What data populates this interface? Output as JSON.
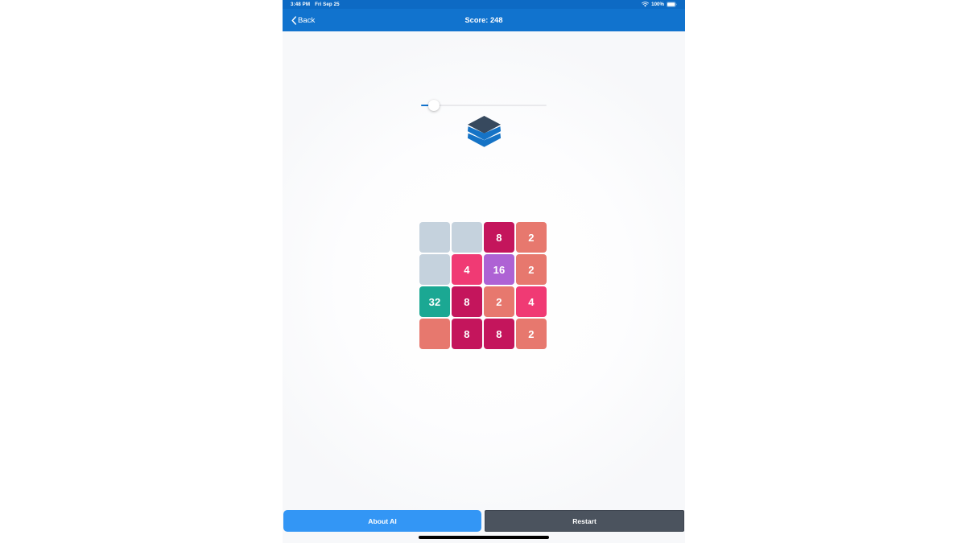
{
  "status_bar": {
    "time": "3:48 PM",
    "date": "Fri Sep 25",
    "wifi_icon": "wifi-icon",
    "battery_percent": "100%",
    "battery_icon": "battery-full-icon",
    "background_color": "#0d6ac4"
  },
  "nav_bar": {
    "back_label": "Back",
    "back_icon": "chevron-left-icon",
    "title": "Score: 248",
    "score_value": 248,
    "background_color": "#1173ce"
  },
  "slider": {
    "name": "speed-slider",
    "value_fraction": 0.077,
    "fill_color": "#1173ce",
    "track_color": "#e9e9ec",
    "thumb_color": "#ffffff"
  },
  "logo": {
    "icon": "layers-stack-icon",
    "top_layer_color": "#37495e",
    "mid_layer_color": "#1573c6",
    "bottom_layer_color": "#1573c6"
  },
  "board": {
    "name": "2048-game-board",
    "rows": 4,
    "columns": 4,
    "empty_color": "#c5d2dd",
    "tiles": [
      [
        {
          "value": "",
          "color": "#c5d2dd",
          "empty": true
        },
        {
          "value": "",
          "color": "#c5d2dd",
          "empty": true
        },
        {
          "value": "8",
          "color": "#c4155c",
          "empty": false
        },
        {
          "value": "2",
          "color": "#e7786e",
          "empty": false
        }
      ],
      [
        {
          "value": "",
          "color": "#c5d2dd",
          "empty": true
        },
        {
          "value": "4",
          "color": "#f03a74",
          "empty": false
        },
        {
          "value": "16",
          "color": "#ae62d4",
          "empty": false
        },
        {
          "value": "2",
          "color": "#e7786e",
          "empty": false
        }
      ],
      [
        {
          "value": "32",
          "color": "#1ba893",
          "empty": false
        },
        {
          "value": "8",
          "color": "#c4155c",
          "empty": false
        },
        {
          "value": "2",
          "color": "#e7786e",
          "empty": false
        },
        {
          "value": "4",
          "color": "#f03a74",
          "empty": false
        }
      ],
      [
        {
          "value": "",
          "color": "#e7786e",
          "empty": false
        },
        {
          "value": "8",
          "color": "#c4155c",
          "empty": false
        },
        {
          "value": "8",
          "color": "#c4155c",
          "empty": false
        },
        {
          "value": "2",
          "color": "#e7786e",
          "empty": false
        }
      ]
    ]
  },
  "buttons": {
    "about_label": "About AI",
    "about_color": "#3396f5",
    "restart_label": "Restart",
    "restart_color": "#4b535e"
  }
}
